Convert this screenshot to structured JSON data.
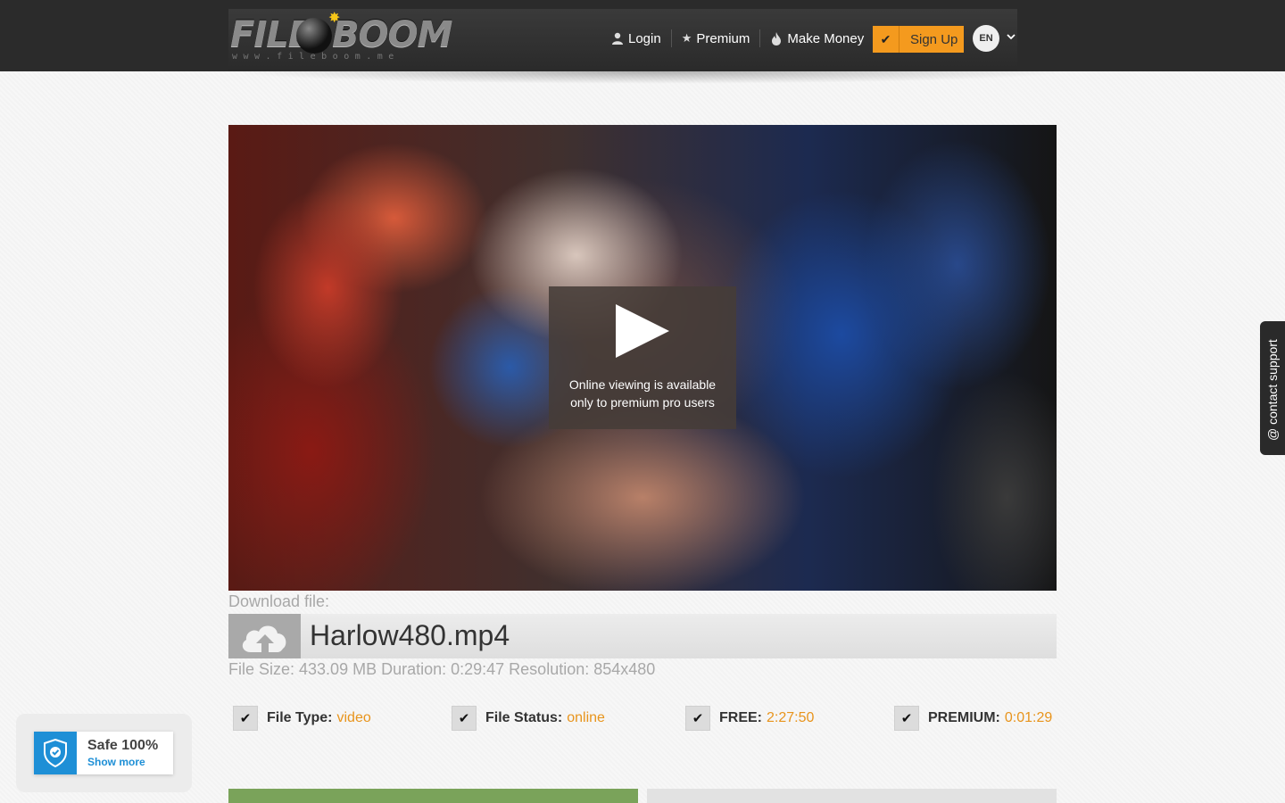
{
  "header": {
    "logo": {
      "word1": "FILE",
      "word2": "BOOM",
      "url": "www.fileboom.me"
    },
    "nav": {
      "login": "Login",
      "premium": "Premium",
      "make_money": "Make Money",
      "signup": "Sign Up",
      "language": "EN"
    }
  },
  "video": {
    "overlay_text": "Online viewing is available only to premium pro users"
  },
  "download": {
    "label": "Download file:",
    "file_name": "Harlow480.mp4",
    "meta": "File Size: 433.09 MB Duration: 0:29:47 Resolution: 854x480"
  },
  "props": {
    "file_type": {
      "label": "File Type:",
      "value": "video"
    },
    "file_status": {
      "label": "File Status:",
      "value": "online"
    },
    "free": {
      "label": "FREE:",
      "value": "2:27:50"
    },
    "premium": {
      "label": "PREMIUM:",
      "value": "0:01:29"
    }
  },
  "support": {
    "label": "@ contact support"
  },
  "safe_badge": {
    "title": "Safe 100%",
    "link": "Show more"
  },
  "colors": {
    "accent_orange": "#f49a1e",
    "header_bg": "#2b2b2b",
    "value_orange": "#e8941c",
    "safe_blue": "#1e8fd6",
    "green_button": "#7aa35a"
  },
  "icons": [
    "user-icon",
    "star-icon",
    "flame-icon",
    "check-icon",
    "chevron-down-icon",
    "play-icon",
    "cloud-upload-icon",
    "shield-check-icon"
  ]
}
